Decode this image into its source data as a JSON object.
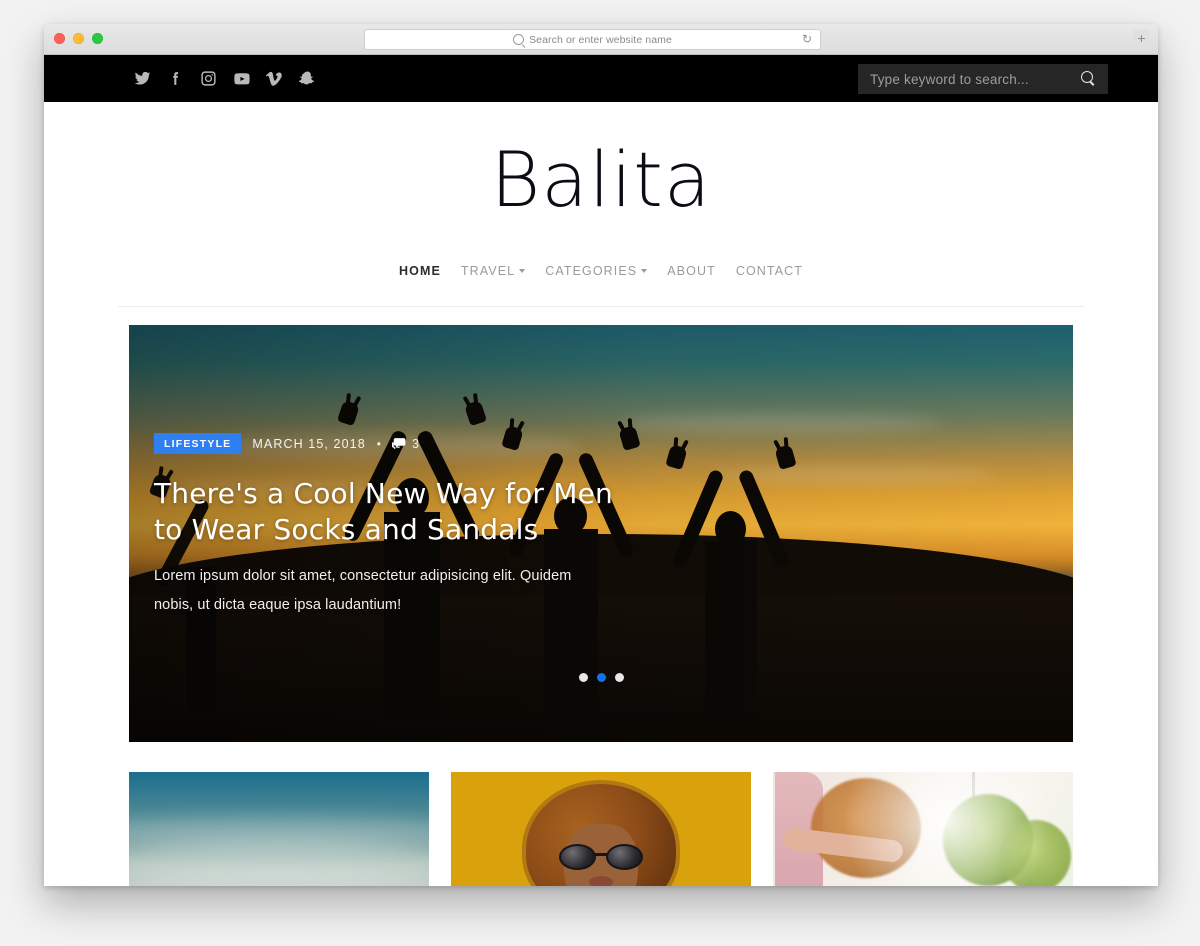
{
  "browser": {
    "address_placeholder": "Search or enter website name",
    "reload_icon": "reload-icon",
    "new_tab_label": "+",
    "traffic_lights": [
      "close",
      "minimize",
      "zoom"
    ]
  },
  "topbar": {
    "social": [
      {
        "name": "twitter-icon",
        "label": "Twitter"
      },
      {
        "name": "facebook-icon",
        "label": "Facebook"
      },
      {
        "name": "instagram-icon",
        "label": "Instagram"
      },
      {
        "name": "youtube-icon",
        "label": "YouTube"
      },
      {
        "name": "vimeo-icon",
        "label": "Vimeo"
      },
      {
        "name": "snapchat-icon",
        "label": "Snapchat"
      }
    ],
    "search_placeholder": "Type keyword to search...",
    "search_icon": "search-icon",
    "background": "#000000",
    "field_background": "#262626"
  },
  "header": {
    "logo": "Balita"
  },
  "nav": {
    "items": [
      {
        "label": "HOME",
        "active": true,
        "caret": false
      },
      {
        "label": "TRAVEL",
        "active": false,
        "caret": true
      },
      {
        "label": "CATEGORIES",
        "active": false,
        "caret": true
      },
      {
        "label": "ABOUT",
        "active": false,
        "caret": false
      },
      {
        "label": "CONTACT",
        "active": false,
        "caret": false
      }
    ]
  },
  "hero": {
    "category": "LIFESTYLE",
    "category_color": "#2f7ff0",
    "date": "MARCH 15, 2018",
    "separator": "•",
    "comments": "3",
    "comment_icon": "comment-icon",
    "title": "There's a Cool New Way for Men to Wear Socks and Sandals",
    "excerpt": "Lorem ipsum dolor sit amet, consectetur adipisicing elit. Quidem nobis, ut dicta eaque ipsa laudantium!",
    "image_description": "Silhouettes of people with arms raised at sunset",
    "slides": [
      {
        "active": false
      },
      {
        "active": true
      },
      {
        "active": false
      }
    ],
    "active_dot_color": "#1273ec"
  },
  "cards": [
    {
      "name": "post-card-sky",
      "image_description": "Blue sky with clouds"
    },
    {
      "name": "post-card-portrait",
      "image_description": "Woman with curly hair and sunglasses on yellow background"
    },
    {
      "name": "post-card-outdoor",
      "image_description": "Bright sunlit outdoor scene with greenery"
    }
  ]
}
